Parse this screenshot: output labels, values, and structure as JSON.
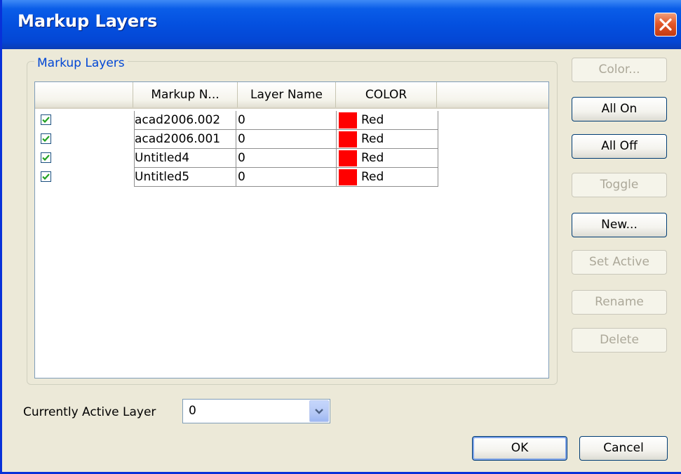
{
  "window": {
    "title": "Markup Layers"
  },
  "group": {
    "label": "Markup Layers"
  },
  "table": {
    "columns": [
      "",
      "Markup N...",
      "Layer Name",
      "COLOR"
    ],
    "rows": [
      {
        "checked": true,
        "markup": "acad2006.002",
        "layer": "0",
        "color_hex": "#FF0000",
        "color_name": "Red"
      },
      {
        "checked": true,
        "markup": "acad2006.001",
        "layer": "0",
        "color_hex": "#FF0000",
        "color_name": "Red"
      },
      {
        "checked": true,
        "markup": "Untitled4",
        "layer": "0",
        "color_hex": "#FF0000",
        "color_name": "Red"
      },
      {
        "checked": true,
        "markup": "Untitled5",
        "layer": "0",
        "color_hex": "#FF0000",
        "color_name": "Red"
      }
    ]
  },
  "buttons": {
    "color": "Color...",
    "all_on": "All On",
    "all_off": "All Off",
    "toggle": "Toggle",
    "new": "New...",
    "set_active": "Set Active",
    "rename": "Rename",
    "delete": "Delete",
    "ok": "OK",
    "cancel": "Cancel"
  },
  "active_layer": {
    "label": "Currently Active Layer",
    "value": "0"
  },
  "colors": {
    "titlebar": "#0450DF",
    "group_label": "#0046D5",
    "dialog_bg": "#ECE9D8",
    "checkmark": "#21A121"
  },
  "icons": {
    "close": "close-icon",
    "check": "checkmark-icon",
    "dropdown": "chevron-down-icon"
  }
}
